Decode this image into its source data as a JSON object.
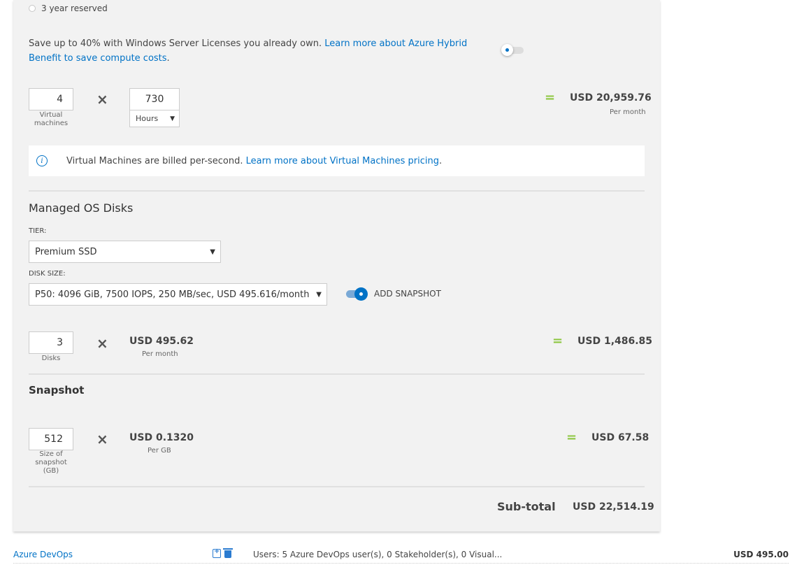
{
  "reservation": {
    "option_label": "3 year reserved"
  },
  "hybrid_benefit": {
    "text": "Save up to 40% with Windows Server Licenses you already own. ",
    "link_text": "Learn more about Azure Hybrid Benefit to save compute costs",
    "suffix": ".",
    "toggle_on": false
  },
  "vm_calc": {
    "vm_count": "4",
    "vm_caption": "Virtual machines",
    "hours_value": "730",
    "hours_unit": "Hours",
    "total": "USD 20,959.76",
    "total_period": "Per month"
  },
  "info": {
    "text": "Virtual Machines are billed per-second. ",
    "link_text": "Learn more about Virtual Machines pricing",
    "suffix": "."
  },
  "managed_disks": {
    "title": "Managed OS Disks",
    "tier_label": "TIER:",
    "tier_value": "Premium SSD",
    "disk_size_label": "DISK SIZE:",
    "disk_size_value": "P50: 4096 GiB, 7500 IOPS, 250 MB/sec, USD 495.616/month",
    "snapshot_toggle_label": "ADD SNAPSHOT",
    "snapshot_toggle_on": true,
    "disk_count": "3",
    "disk_caption": "Disks",
    "unit_price": "USD 495.62",
    "unit_period": "Per month",
    "total": "USD 1,486.85"
  },
  "snapshot": {
    "title": "Snapshot",
    "size_value": "512",
    "size_caption": "Size of snapshot (GB)",
    "unit_price": "USD 0.1320",
    "unit_period": "Per GB",
    "total": "USD 67.58"
  },
  "operators": {
    "times": "×",
    "equals": "="
  },
  "subtotal": {
    "label": "Sub-total",
    "value": "USD 22,514.19"
  },
  "footer_item": {
    "name": "Azure DevOps",
    "summary": "Users: 5 Azure DevOps user(s), 0 Stakeholder(s), 0 Visual...",
    "price": "USD 495.00"
  },
  "colors": {
    "link": "#0072c6",
    "equals": "#8cc63f",
    "panel_bg": "#f2f2f2"
  }
}
